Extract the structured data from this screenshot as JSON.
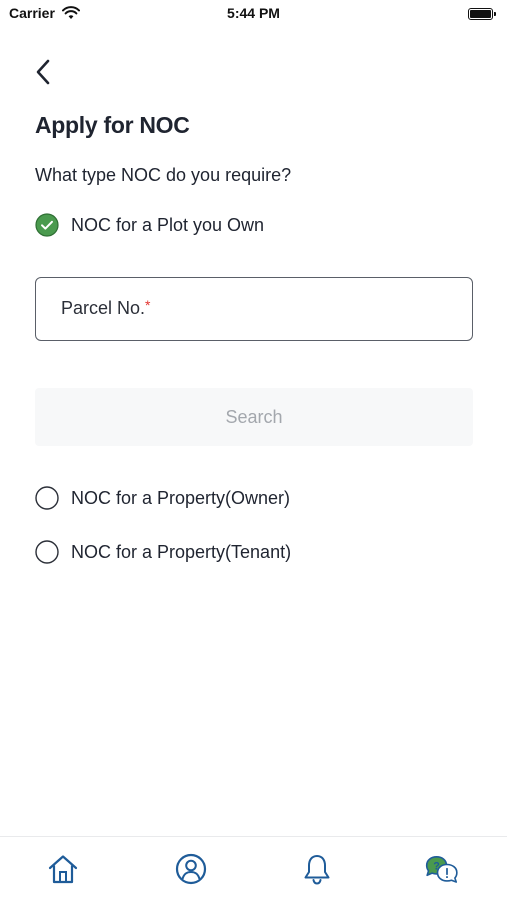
{
  "status_bar": {
    "carrier": "Carrier",
    "time": "5:44 PM"
  },
  "page": {
    "title": "Apply for NOC",
    "question": "What type NOC do you require?"
  },
  "options": [
    {
      "label": "NOC for a Plot you Own",
      "selected": true
    },
    {
      "label": "NOC for a Property(Owner)",
      "selected": false
    },
    {
      "label": "NOC for a Property(Tenant)",
      "selected": false
    }
  ],
  "parcel_field": {
    "placeholder": "Parcel No.",
    "required_mark": "*"
  },
  "search_button": {
    "label": "Search"
  },
  "tab_bar": {
    "items": [
      {
        "icon": "home-icon"
      },
      {
        "icon": "profile-icon"
      },
      {
        "icon": "bell-icon"
      },
      {
        "icon": "help-chat-icon"
      }
    ]
  },
  "colors": {
    "accent_blue": "#1f5c99",
    "selected_green": "#4a9a4e",
    "text_dark": "#1f2430",
    "required_red": "#e3342f"
  }
}
